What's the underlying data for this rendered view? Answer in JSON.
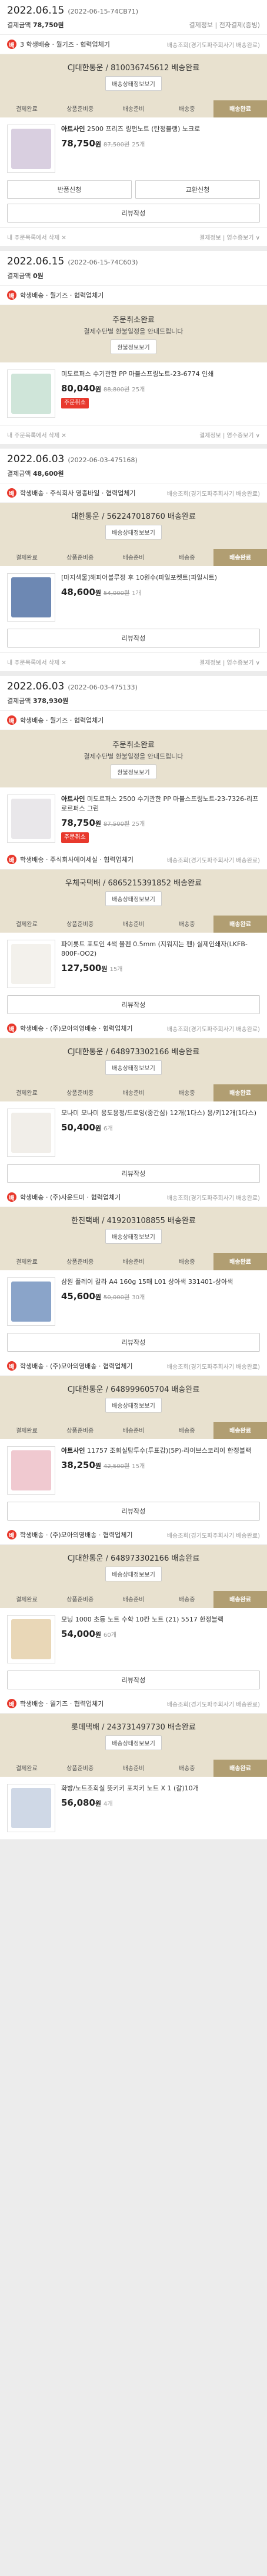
{
  "orders": [
    {
      "date": "2022.06.15",
      "no": "(2022-06-15-74CB71)",
      "total_label": "결제금액",
      "total": "78,750원",
      "right_links": "결제정보 | 전자결제(증빙)",
      "groups": [
        {
          "seller_label": "3 학생배송 · 월기즈 · 협력업체기",
          "seller_right": "배송조회(경기도파주회사기 배송완료)",
          "box_title": "CJ대한통운 / 810036745612 배송완료",
          "box_track": "배송상태정보보기",
          "steps": [
            "결제완료",
            "상품준비중",
            "배송준비",
            "배송중",
            "배송완료"
          ],
          "product": {
            "name_bold": "아트사인",
            "name": "2500 프리즈 링펀노트 (탄정블랭) 노크로",
            "price": "78,750",
            "unit": "원",
            "orig": "87,500원",
            "qty": "25개",
            "color": "#d9cfe0"
          },
          "buttons": [
            "반품신청",
            "교환신청"
          ],
          "review": "리뷰작성"
        }
      ],
      "footer_left": "내 주문목록에서 삭제 ✕",
      "footer_right": "결제정보 | 영수증보기 ∨"
    },
    {
      "date": "2022.06.15",
      "no": "(2022-06-15-74C603)",
      "total_label": "결제금액",
      "total": "0원",
      "right_links": "",
      "groups": [
        {
          "seller_label": "학생배송 · 월기즈 · 협력업체기",
          "seller_right": "",
          "cancel_title": "주문취소완료",
          "cancel_sub": "결제수단별 환불일정을 안내드립니다",
          "cancel_btn": "환불정보보기",
          "product": {
            "name_bold": "",
            "name": "미도르퍼스 수기관한 PP 마블스프링노트-23-6774 인쇄",
            "price": "80,040",
            "unit": "원",
            "orig": "88,800원",
            "qty": "25개",
            "status": "주문취소",
            "color": "#cfe5d9"
          }
        }
      ],
      "footer_left": "내 주문목록에서 삭제 ✕",
      "footer_right": "결제정보 | 영수증보기 ∨"
    },
    {
      "date": "2022.06.03",
      "no": "(2022-06-03-475168)",
      "total_label": "결제금액",
      "total": "48,600원",
      "right_links": "",
      "groups": [
        {
          "seller_label": "학생배송 · 주식회사 영종바일 · 협력업체기",
          "seller_right": "배송조회(경기도파주회사기 배송완료)",
          "box_title": "대한통운 / 562247018760 배송완료",
          "box_track": "배송상태정보보기",
          "steps": [
            "결제완료",
            "상품준비중",
            "배송준비",
            "배송중",
            "배송완료"
          ],
          "product": {
            "name_bold": "",
            "name": "[마지색물]해피어블루정 후 10원수(파일포켓트(파일시트)",
            "price": "48,600",
            "unit": "원",
            "orig": "54,000원",
            "qty": "1개",
            "color": "#6d88b3"
          },
          "review": "리뷰작성"
        }
      ],
      "footer_left": "내 주문목록에서 삭제 ✕",
      "footer_right": "결제정보 | 영수증보기 ∨"
    },
    {
      "date": "2022.06.03",
      "no": "(2022-06-03-475133)",
      "total_label": "결제금액",
      "total": "378,930원",
      "right_links": "",
      "groups": [
        {
          "seller_label": "학생배송 · 월기즈 · 협력업체기",
          "seller_right": "",
          "cancel_title": "주문취소완료",
          "cancel_sub": "결제수단별 환불일정을 안내드립니다",
          "cancel_btn": "환불정보보기",
          "product": {
            "name_bold": "아트사인",
            "name": "미도르퍼스 2500 수기관한 PP 마블스프링노트-23-7326-리프로르퍼스 그린",
            "price": "78,750",
            "unit": "원",
            "orig": "87,500원",
            "qty": "25개",
            "status": "주문취소",
            "color": "#e9e7ea"
          }
        },
        {
          "seller_label": "학생배송 · 주식회사에이세실 · 협력업체기",
          "seller_right": "배송조회(경기도파주회사기 배송완료)",
          "box_title": "우체국택배 / 6865215391852 배송완료",
          "box_track": "배송상태정보보기",
          "steps": [
            "결제완료",
            "상품준비중",
            "배송준비",
            "배송중",
            "배송완료"
          ],
          "product": {
            "name_bold": "",
            "name": "파이롯트 포토인 4색 볼펜 0.5mm (지워지는 펜) 실제인쇄자(LKFB-800F-OO2)",
            "price": "127,500",
            "unit": "원",
            "orig": "",
            "qty": "15개",
            "color": "#f3f1ec"
          },
          "review": "리뷰작성"
        },
        {
          "seller_label": "학생배송 · (주)모아의영배송 · 협력업체기",
          "seller_right": "배송조회(경기도파주회사기 배송완료)",
          "box_title": "CJ대한통운 / 648973302166 배송완료",
          "box_track": "배송상태정보보기",
          "steps": [
            "결제완료",
            "상품준비중",
            "배송준비",
            "배송중",
            "배송완료"
          ],
          "product": {
            "name_bold": "",
            "name": "모나미 모나미 용도용정/드로잉(중간심) 12개(1다스) 용/키12개(1다스)",
            "price": "50,400",
            "unit": "원",
            "orig": "",
            "qty": "6개",
            "color": "#f1eee9"
          },
          "review": "리뷰작성"
        },
        {
          "seller_label": "학생배송 · (주)사운드미 · 협력업체기",
          "seller_right": "배송조회(경기도파주회사기 배송완료)",
          "box_title": "한진택배 / 419203108855 배송완료",
          "box_track": "배송상태정보보기",
          "steps": [
            "결제완료",
            "상품준비중",
            "배송준비",
            "배송중",
            "배송완료"
          ],
          "product": {
            "name_bold": "",
            "name": "삼원 플레이 칼라 A4 160g 15매 L01 상아색 331401-상아색",
            "price": "45,600",
            "unit": "원",
            "orig": "50,000원",
            "qty": "30개",
            "color": "#8aa4c9"
          },
          "review": "리뷰작성"
        },
        {
          "seller_label": "학생배송 · (주)모아의영배송 · 협력업체기",
          "seller_right": "배송조회(경기도파주회사기 배송완료)",
          "box_title": "CJ대한통운 / 648999605704 배송완료",
          "box_track": "배송상태정보보기",
          "steps": [
            "결제완료",
            "상품준비중",
            "배송준비",
            "배송중",
            "배송완료"
          ],
          "product": {
            "name_bold": "아트사인",
            "name": "11757 조회실탐투수(투표감)(5P)-라이브스코리이 한정블랙",
            "price": "38,250",
            "unit": "원",
            "orig": "42,500원",
            "qty": "15개",
            "color": "#f0c9d0"
          },
          "review": "리뷰작성"
        },
        {
          "seller_label": "학생배송 · (주)모아의영배송 · 협력업체기",
          "seller_right": "배송조회(경기도파주회사기 배송완료)",
          "box_title": "CJ대한통운 / 648973302166 배송완료",
          "box_track": "배송상태정보보기",
          "steps": [
            "결제완료",
            "상품준비중",
            "배송준비",
            "배송중",
            "배송완료"
          ],
          "product": {
            "name_bold": "",
            "name": "모닝 1000 초등 노트 수학 10칸 노트 (21) 5517 한정블랙",
            "price": "54,000",
            "unit": "원",
            "orig": "",
            "qty": "60개",
            "color": "#e9d7b7"
          },
          "review": "리뷰작성"
        },
        {
          "seller_label": "학생배송 · 월기즈 · 협력업체기",
          "seller_right": "배송조회(경기도파주회사기 배송완료)",
          "box_title": "롯데택배 / 243731497730 배송완료",
          "box_track": "배송상태정보보기",
          "steps": [
            "결제완료",
            "상품준비중",
            "배송준비",
            "배송중",
            "배송완료"
          ],
          "product": {
            "name_bold": "",
            "name": "화방/노트조회실 뜻키키 포치키 노트 X 1 (갈)10개",
            "price": "56,080",
            "unit": "원",
            "orig": "",
            "qty": "4개",
            "color": "#cfd8e6"
          },
          "review": ""
        }
      ],
      "footer_left": "",
      "footer_right": ""
    }
  ]
}
